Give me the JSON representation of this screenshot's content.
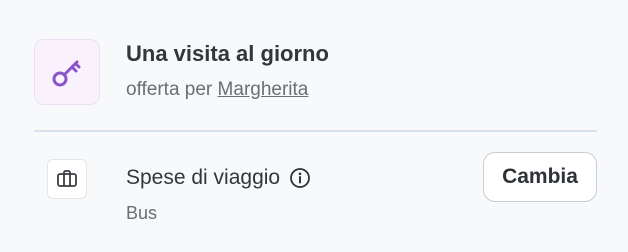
{
  "offer": {
    "title": "Una visita al giorno",
    "offered_by": "offerta per",
    "host_name": "Margherita",
    "icon": "key-icon",
    "icon_color": "#8a55c9",
    "icon_bg": "#f9f1fc"
  },
  "travel": {
    "title": "Spese di viaggio",
    "value": "Bus",
    "icon": "briefcase-icon",
    "info_icon": "info-icon",
    "change_label": "Cambia"
  }
}
